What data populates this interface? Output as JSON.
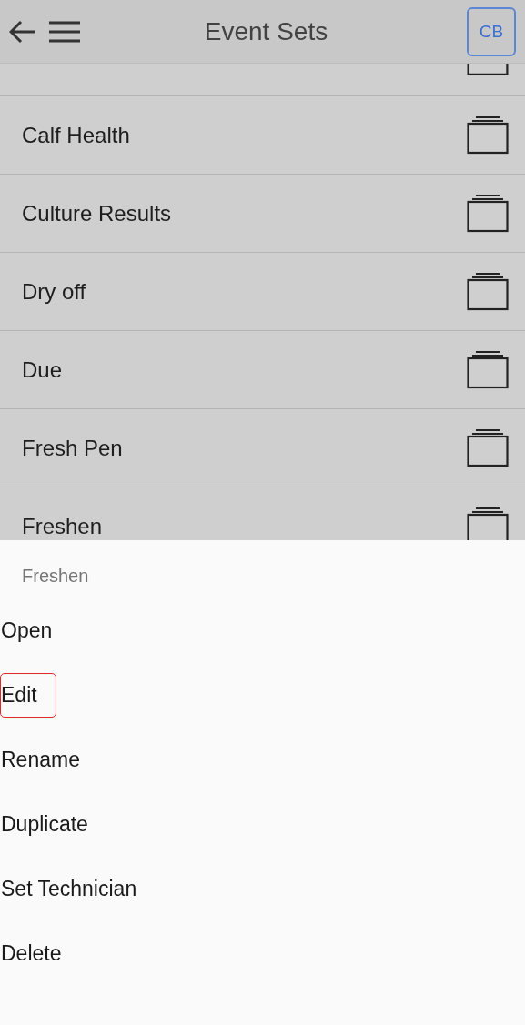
{
  "app_bar": {
    "title": "Event Sets",
    "avatar": "CB"
  },
  "event_sets": [
    {
      "name": "Calf Health"
    },
    {
      "name": "Culture Results"
    },
    {
      "name": "Dry off"
    },
    {
      "name": "Due"
    },
    {
      "name": "Fresh Pen"
    },
    {
      "name": "Freshen"
    }
  ],
  "action_sheet": {
    "title": "Freshen",
    "actions": [
      {
        "label": "Open",
        "selected": false
      },
      {
        "label": "Edit",
        "selected": true
      },
      {
        "label": "Rename",
        "selected": false
      },
      {
        "label": "Duplicate",
        "selected": false
      },
      {
        "label": "Set Technician",
        "selected": false
      },
      {
        "label": "Delete",
        "selected": false
      }
    ]
  }
}
